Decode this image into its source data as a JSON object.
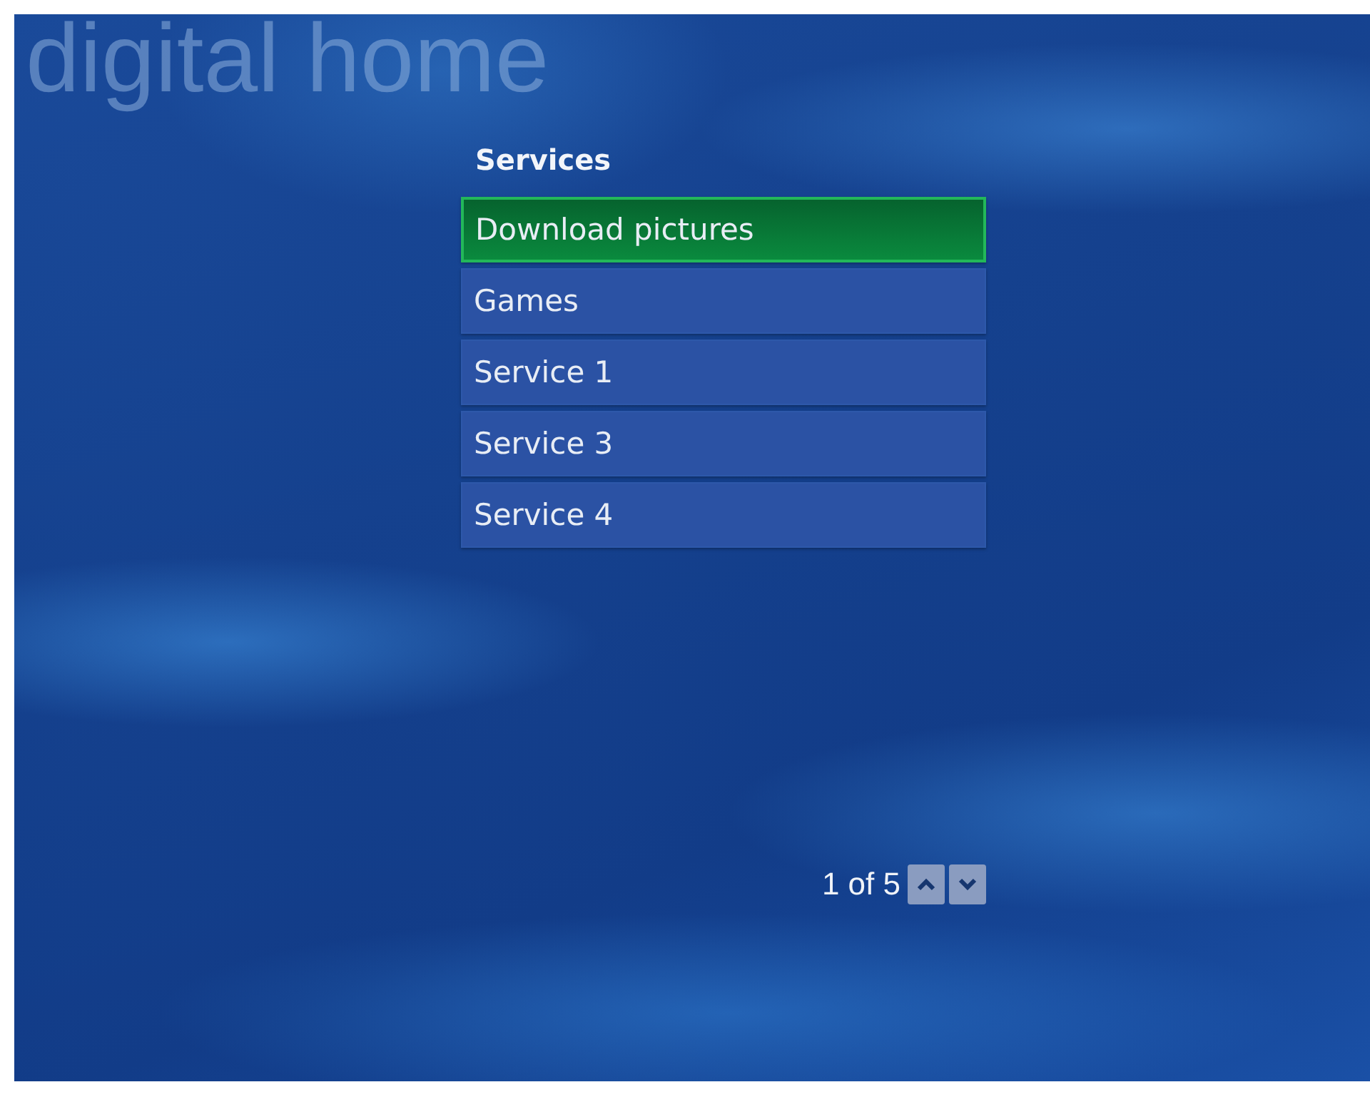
{
  "brand": "digital home",
  "section_title": "Services",
  "menu": [
    {
      "label": "Download pictures",
      "selected": true
    },
    {
      "label": "Games",
      "selected": false
    },
    {
      "label": "Service 1",
      "selected": false
    },
    {
      "label": "Service 3",
      "selected": false
    },
    {
      "label": "Service 4",
      "selected": false
    }
  ],
  "pager": {
    "text": "1 of 5"
  }
}
